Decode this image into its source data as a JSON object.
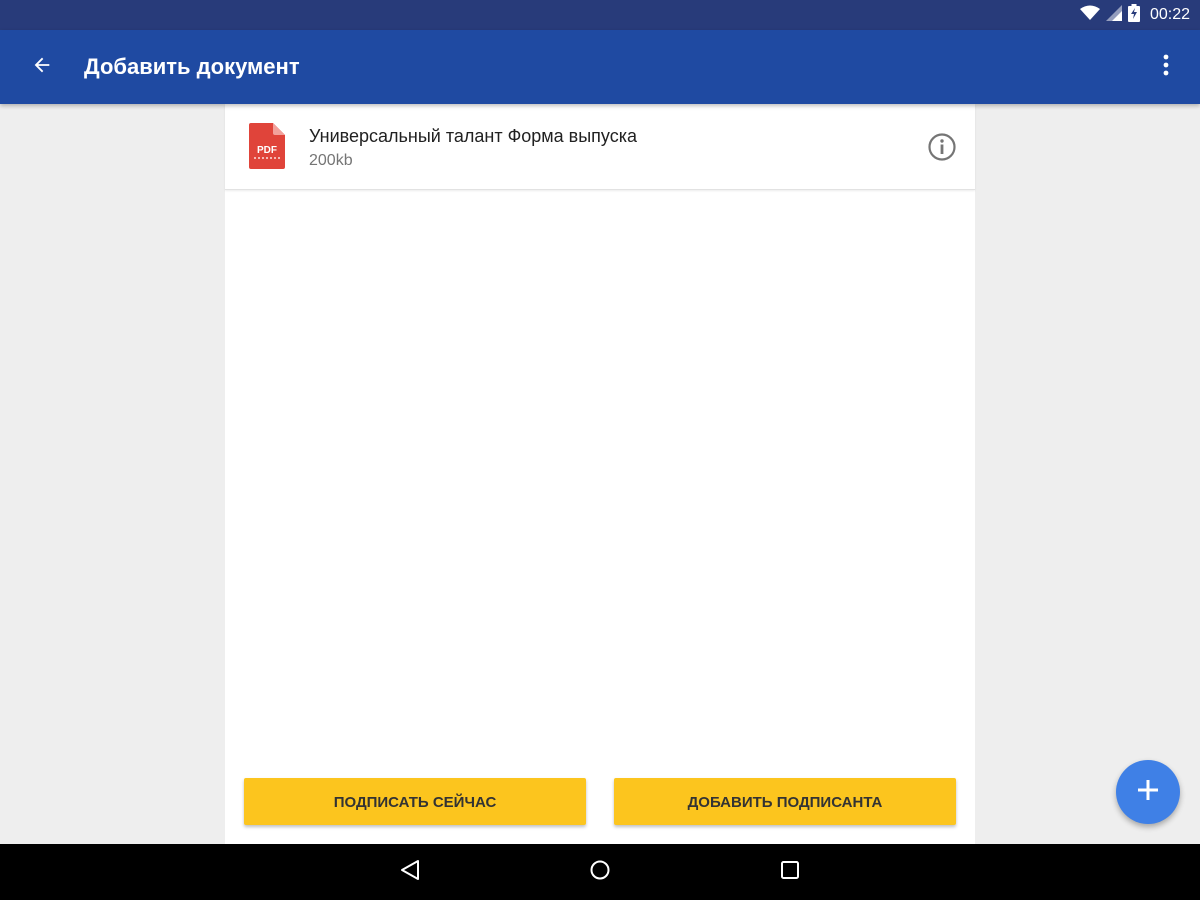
{
  "status_bar": {
    "time": "00:22"
  },
  "app_bar": {
    "title": "Добавить документ"
  },
  "document": {
    "title": "Универсальный талант Форма выпуска",
    "size": "200kb",
    "type_label": "PDF"
  },
  "actions": {
    "sign_now": "ПОДПИСАТЬ СЕЙЧАС",
    "add_signer": "ДОБАВИТЬ ПОДПИСАНТА"
  },
  "icons": {
    "back": "arrow-back-icon",
    "overflow": "more-vert-icon",
    "info": "info-icon",
    "file": "pdf-file-icon",
    "fab": "plus-icon",
    "wifi": "wifi-icon",
    "signal": "signal-icon",
    "battery": "battery-charging-icon",
    "nav_back": "nav-back-icon",
    "nav_home": "nav-home-icon",
    "nav_recents": "nav-recents-icon"
  },
  "colors": {
    "status_bar": "#283b7a",
    "app_bar": "#1f4aa2",
    "background": "#eeeeee",
    "button": "#fcc51e",
    "fab": "#3f80e6",
    "pdf": "#e0443a"
  }
}
